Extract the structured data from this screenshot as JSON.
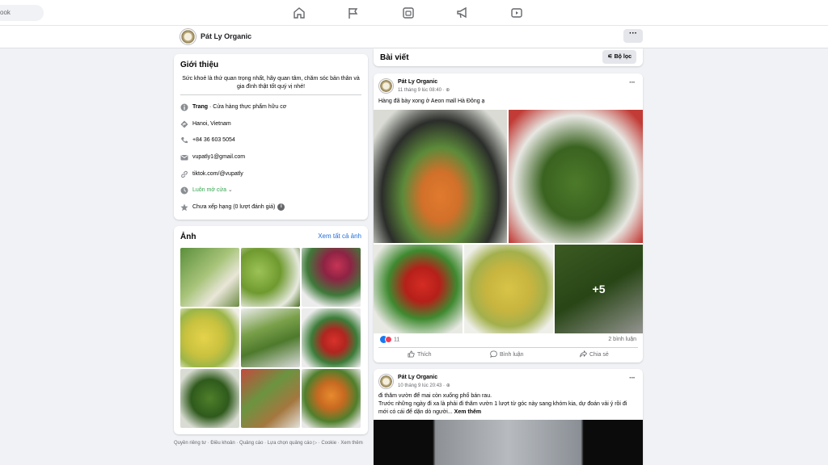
{
  "topnav": {
    "search_text": "ook",
    "icons": [
      "home-icon",
      "flag-icon",
      "gaming-icon",
      "megaphone-icon",
      "video-icon"
    ]
  },
  "page": {
    "name": "Pát Ly Organic",
    "more_label": "···"
  },
  "intro": {
    "title": "Giới thiệu",
    "bio": "Sức khoẻ là thứ quan trọng nhất, hãy quan tâm, chăm sóc bản thân và gia đình thật tốt quý vị nhé!",
    "category_bold": "Trang",
    "category_rest": " · Cửa hàng thực phẩm hữu cơ",
    "location": "Hanoi, Vietnam",
    "phone": "+84 36 603 5054",
    "email": "vupatly1@gmail.com",
    "website": "tiktok.com/@vupatly",
    "hours": "Luôn mở cửa",
    "rating": "Chưa xếp hạng (0 lượt đánh giá)"
  },
  "photos": {
    "title": "Ảnh",
    "see_all": "Xem tất cả ảnh"
  },
  "footer": {
    "text": "Quyền riêng tư · Điều khoản · Quảng cáo · Lựa chọn quảng cáo ▷ · Cookie · Xem thêm"
  },
  "posts_header": {
    "title": "Bài viết",
    "filter_label": "Bộ lọc"
  },
  "posts": [
    {
      "author": "Pát Ly Organic",
      "time": "11 tháng 9 lúc 08:40 · ",
      "text": "Hàng đã bày xong ở Aeon mall Hà Đông ạ",
      "more_photos": "+5",
      "reaction_count": "11",
      "comment_count": "2 bình luận",
      "actions": [
        "Thích",
        "Bình luận",
        "Chia sẻ"
      ]
    },
    {
      "author": "Pát Ly Organic",
      "time": "10 tháng 9 lúc 20:43 · ",
      "text_line1": "đi thăm vườn để mai còn xuống phố bán rau.",
      "text_line2": "Trước những ngày đi xa là phải đi thăm vườn 1 lượt từ góc này sang khóm kia, dự đoán vải ý rồi đi mới có cái để dặn dò người...",
      "see_more": " Xem thêm"
    }
  ],
  "colors": {
    "accent": "#1877f2",
    "link": "#216fdb",
    "green": "#31a24c",
    "background": "#f0f2f5"
  }
}
